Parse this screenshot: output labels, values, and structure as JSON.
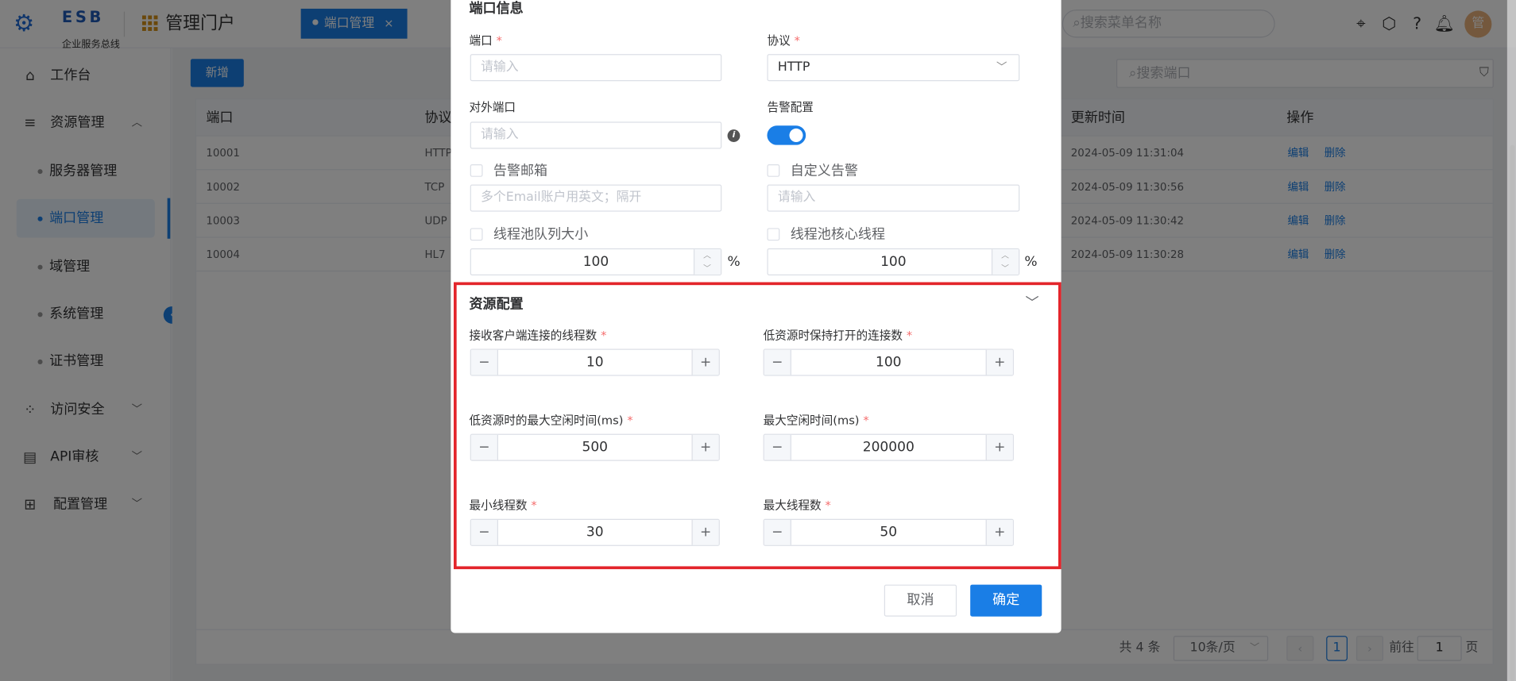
{
  "header": {
    "logo_title": "ESB",
    "logo_subtitle": "企业服务总线",
    "portal_title": "管理门户",
    "tab_label": "端口管理",
    "tab_close": "×",
    "search_placeholder": "搜索菜单名称",
    "avatar_text": "管"
  },
  "sidebar": {
    "workbench": "工作台",
    "resource": "资源管理",
    "server": "服务器管理",
    "port": "端口管理",
    "domain": "域管理",
    "system": "系统管理",
    "cert": "证书管理",
    "access": "访问安全",
    "api": "API审核",
    "config": "配置管理"
  },
  "toolbar": {
    "new_label": "新增",
    "search_placeholder": "搜索端口"
  },
  "table": {
    "headers": [
      "端口",
      "协议",
      "更新时间",
      "操作"
    ],
    "rows": [
      {
        "port": "10001",
        "protocol": "HTTP",
        "updated": "2024-05-09 11:31:04"
      },
      {
        "port": "10002",
        "protocol": "TCP",
        "updated": "2024-05-09 11:30:56"
      },
      {
        "port": "10003",
        "protocol": "UDP",
        "updated": "2024-05-09 11:30:42"
      },
      {
        "port": "10004",
        "protocol": "HL7",
        "updated": "2024-05-09 11:30:28"
      }
    ],
    "edit_label": "编辑",
    "delete_label": "删除"
  },
  "pagination": {
    "total": "共 4 条",
    "page_size": "10条/页",
    "current_page": "1",
    "goto_prefix": "前往",
    "goto_value": "1",
    "goto_suffix": "页"
  },
  "dialog": {
    "port_info_title": "端口信息",
    "port_label": "端口",
    "port_placeholder": "请输入",
    "protocol_label": "协议",
    "protocol_value": "HTTP",
    "external_port_label": "对外端口",
    "external_port_placeholder": "请输入",
    "alert_config_label": "告警配置",
    "alert_email_label": "告警邮箱",
    "alert_email_placeholder": "多个Email账户用英文；隔开",
    "custom_alert_label": "自定义告警",
    "custom_alert_placeholder": "请输入",
    "queue_size_label": "线程池队列大小",
    "queue_size_value": "100",
    "core_threads_label": "线程池核心线程",
    "core_threads_value": "100",
    "percent": "%",
    "resource_title": "资源配置",
    "accept_threads_label": "接收客户端连接的线程数",
    "accept_threads_value": "10",
    "low_res_conn_label": "低资源时保持打开的连接数",
    "low_res_conn_value": "100",
    "low_res_idle_label": "低资源时的最大空闲时间(ms)",
    "low_res_idle_value": "500",
    "max_idle_label": "最大空闲时间(ms)",
    "max_idle_value": "200000",
    "min_threads_label": "最小线程数",
    "min_threads_value": "30",
    "max_threads_label": "最大线程数",
    "max_threads_value": "50",
    "required_mark": "*",
    "cancel_label": "取消",
    "ok_label": "确定"
  }
}
